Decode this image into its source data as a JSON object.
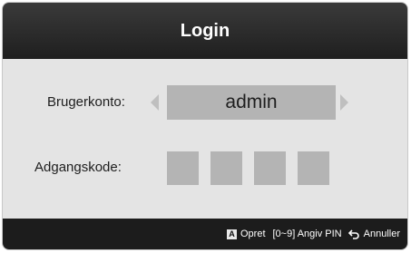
{
  "dialog": {
    "title": "Login"
  },
  "account": {
    "label": "Brugerkonto:",
    "value": "admin"
  },
  "password": {
    "label": "Adgangskode:",
    "pin_length": 4
  },
  "footer": {
    "create_key": "A",
    "create_label": "Opret",
    "pin_hint": "[0~9] Angiv PIN",
    "cancel_label": "Annuller"
  },
  "icons": {
    "left_arrow": "chevron-left-icon",
    "right_arrow": "chevron-right-icon",
    "return": "return-icon"
  },
  "colors": {
    "title_bar": "#2a2a2a",
    "body": "#e4e4e4",
    "field": "#b4b4b4",
    "footer": "#1c1c1c"
  }
}
